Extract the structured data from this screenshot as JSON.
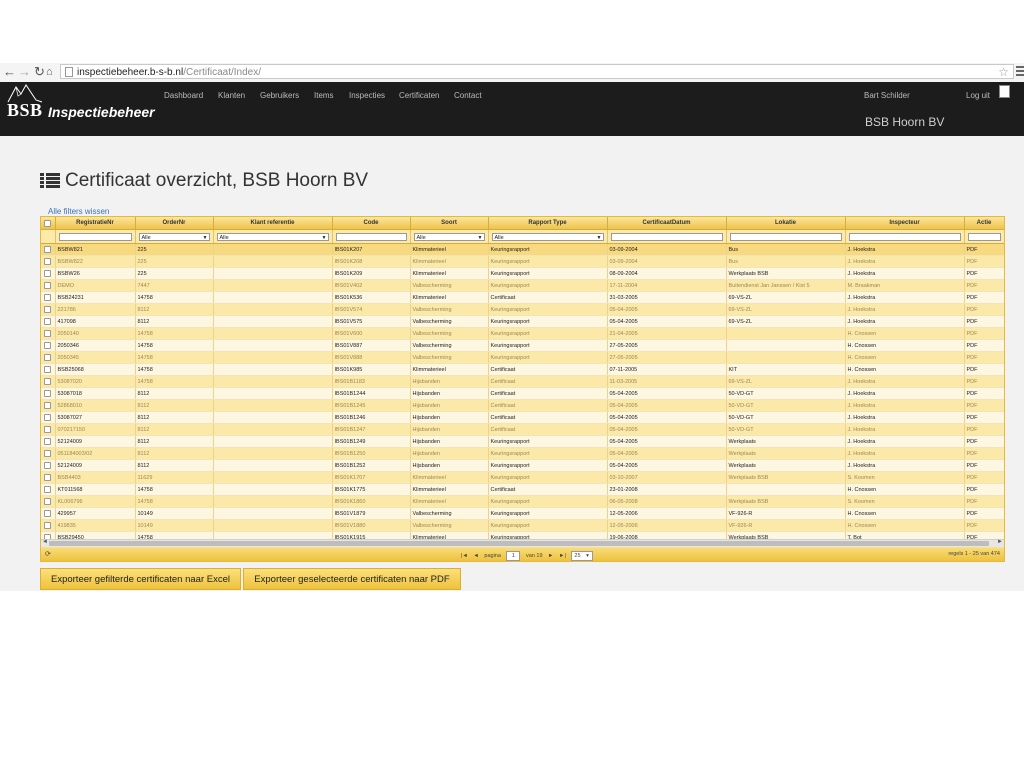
{
  "browser": {
    "url_host": "inspectiebeheer.b-s-b.nl",
    "url_path": "/Certificaat/Index/"
  },
  "app": {
    "brand": "BSB",
    "name": "Inspectiebeheer",
    "nav": [
      "Dashboard",
      "Klanten",
      "Gebruikers",
      "Items",
      "Inspecties",
      "Certificaten",
      "Contact"
    ],
    "user": "Bart Schilder",
    "logout": "Log uit",
    "company": "BSB Hoorn BV"
  },
  "page": {
    "title": "Certificaat overzicht, BSB Hoorn BV",
    "clear_filters": "Alle filters wissen"
  },
  "grid": {
    "columns": [
      "RegistratieNr",
      "OrderNr",
      "Klant referentie",
      "Code",
      "Soort",
      "Rapport Type",
      "CertificaatDatum",
      "Lokatie",
      "Inspecteur",
      "Actie"
    ],
    "filters": [
      "",
      "Alle",
      "Alle",
      "",
      "Alle",
      "Alle",
      "",
      "",
      "",
      ""
    ],
    "rows": [
      [
        "BSBW821",
        "225",
        "",
        "IBS01K207",
        "Klimmaterieel",
        "Keuringsrapport",
        "03-09-2004",
        "Bus",
        "J. Hoekstra",
        "PDF"
      ],
      [
        "BSBW822",
        "225",
        "",
        "IBS01K208",
        "Klimmaterieel",
        "Keuringsrapport",
        "03-09-2004",
        "Bus",
        "J. Hoekstra",
        "PDF"
      ],
      [
        "BSBW26",
        "225",
        "",
        "IBS01K209",
        "Klimmaterieel",
        "Keuringsrapport",
        "08-09-2004",
        "Werkplaats BSB",
        "J. Hoekstra",
        "PDF"
      ],
      [
        "DEMO",
        "7447",
        "",
        "IBS01V402",
        "Valbescherming",
        "Keuringsrapport",
        "17-11-2004",
        "Buitendienst Jan Janssen / Kist 5",
        "M. Braakman",
        "PDF"
      ],
      [
        "BSB24231",
        "14758",
        "",
        "IBS01K536",
        "Klimmaterieel",
        "Certificaat",
        "31-03-2005",
        "69-VS-ZL",
        "J. Hoekstra",
        "PDF"
      ],
      [
        "221786",
        "8112",
        "",
        "IBS01V574",
        "Valbescherming",
        "Keuringsrapport",
        "05-04-2005",
        "69-VS-ZL",
        "J. Hoekstra",
        "PDF"
      ],
      [
        "417098",
        "8112",
        "",
        "IBS01V575",
        "Valbescherming",
        "Keuringsrapport",
        "05-04-2005",
        "69-VS-ZL",
        "J. Hoekstra",
        "PDF"
      ],
      [
        "2050140",
        "14758",
        "",
        "IBS01V600",
        "Valbescherming",
        "Keuringsrapport",
        "21-04-2005",
        "",
        "H. Cnossen",
        "PDF"
      ],
      [
        "2050346",
        "14758",
        "",
        "IBS01V887",
        "Valbescherming",
        "Keuringsrapport",
        "27-05-2005",
        "",
        "H. Cnossen",
        "PDF"
      ],
      [
        "2050345",
        "14758",
        "",
        "IBS01V888",
        "Valbescherming",
        "Keuringsrapport",
        "27-05-2005",
        "",
        "H. Cnossen",
        "PDF"
      ],
      [
        "BSB25068",
        "14758",
        "",
        "IBS01K985",
        "Klimmaterieel",
        "Certificaat",
        "07-11-2005",
        "KIT",
        "H. Cnossen",
        "PDF"
      ],
      [
        "53087020",
        "14758",
        "",
        "IBS01B1183",
        "Hijsbanden",
        "Certificaat",
        "11-03-2005",
        "69-VS-ZL",
        "J. Hoekstra",
        "PDF"
      ],
      [
        "53087018",
        "8112",
        "",
        "IBS01B1244",
        "Hijsbanden",
        "Certificaat",
        "05-04-2005",
        "50-VD-GT",
        "J. Hoekstra",
        "PDF"
      ],
      [
        "52868010",
        "8112",
        "",
        "IBS01B1245",
        "Hijsbanden",
        "Certificaat",
        "05-04-2005",
        "50-VD-GT",
        "J. Hoekstra",
        "PDF"
      ],
      [
        "53087027",
        "8112",
        "",
        "IBS01B1246",
        "Hijsbanden",
        "Certificaat",
        "05-04-2005",
        "50-VD-GT",
        "J. Hoekstra",
        "PDF"
      ],
      [
        "070217150",
        "8112",
        "",
        "IBS01B1247",
        "Hijsbanden",
        "Certificaat",
        "05-04-2005",
        "50-VD-GT",
        "J. Hoekstra",
        "PDF"
      ],
      [
        "52124009",
        "8112",
        "",
        "IBS01B1249",
        "Hijsbanden",
        "Keuringsrapport",
        "05-04-2005",
        "Werkplaats",
        "J. Hoekstra",
        "PDF"
      ],
      [
        "051184003/02",
        "8112",
        "",
        "IBS01B1250",
        "Hijsbanden",
        "Keuringsrapport",
        "05-04-2005",
        "Werkplaats",
        "J. Hoekstra",
        "PDF"
      ],
      [
        "52124009",
        "8112",
        "",
        "IBS01B1252",
        "Hijsbanden",
        "Keuringsrapport",
        "05-04-2005",
        "Werkplaats",
        "J. Hoekstra",
        "PDF"
      ],
      [
        "BSB4403",
        "11629",
        "",
        "IBS01K1707",
        "Klimmaterieel",
        "Keuringsrapport",
        "03-10-2007",
        "Werkplaats BSB",
        "S. Koomen",
        "PDF"
      ],
      [
        "KT011568",
        "14758",
        "",
        "IBS01K1775",
        "Klimmaterieel",
        "Certificaat",
        "23-01-2008",
        "",
        "H. Cnossen",
        "PDF"
      ],
      [
        "KL006796",
        "14758",
        "",
        "IBS01K1860",
        "Klimmaterieel",
        "Keuringsrapport",
        "06-05-2008",
        "Werkplaats BSB",
        "S. Koomen",
        "PDF"
      ],
      [
        "429957",
        "10149",
        "",
        "IBS01V1879",
        "Valbescherming",
        "Keuringsrapport",
        "12-05-2006",
        "VF-926-R",
        "H. Cnossen",
        "PDF"
      ],
      [
        "419835",
        "10149",
        "",
        "IBS01V1880",
        "Valbescherming",
        "Keuringsrapport",
        "12-05-2006",
        "VF-926-R",
        "H. Cnossen",
        "PDF"
      ],
      [
        "BSB29450",
        "14758",
        "",
        "IBS01K1915",
        "Klimmaterieel",
        "Keuringsrapport",
        "19-06-2008",
        "Werkplaats BSB",
        "T. Bot",
        "PDF"
      ]
    ]
  },
  "pager": {
    "page_label": "pagina",
    "page": "1",
    "of_label": "van 19",
    "page_size": "25",
    "records": "regels 1 - 25 van 474"
  },
  "actions": {
    "export_excel": "Exporteer gefilterde certificaten naar Excel",
    "export_pdf": "Exporteer geselecteerde certificaten naar PDF"
  },
  "colors": {
    "navbar": "#1c1c1c",
    "grid_header": "#eec34b",
    "row_alt": "#fbe9a8",
    "row": "#fdf7e2",
    "button": "#f4d05a"
  }
}
